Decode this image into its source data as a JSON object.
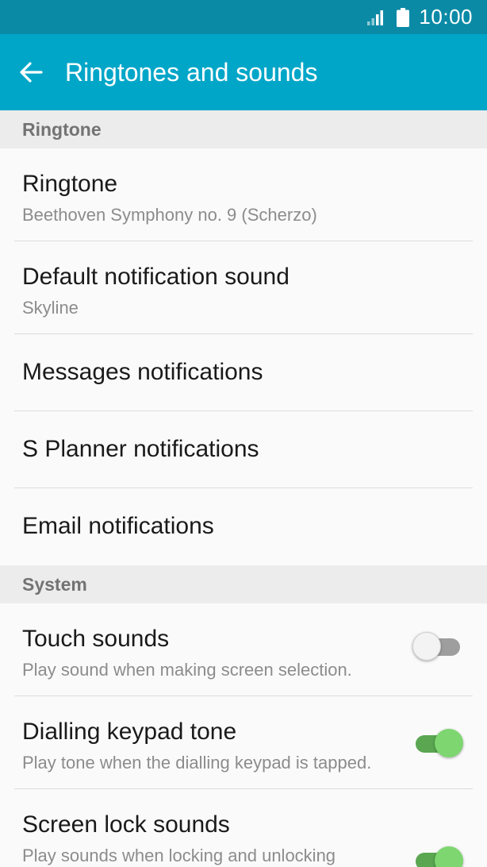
{
  "status_bar": {
    "time": "10:00",
    "icons": [
      "signal-icon",
      "battery-icon"
    ]
  },
  "app_bar": {
    "title": "Ringtones and sounds",
    "back_icon": "arrow-left-icon",
    "color": "#00a6c8"
  },
  "sections": {
    "ringtone": {
      "header": "Ringtone",
      "items": [
        {
          "title": "Ringtone",
          "subtitle": "Beethoven Symphony no. 9 (Scherzo)"
        },
        {
          "title": "Default notification sound",
          "subtitle": "Skyline"
        },
        {
          "title": "Messages notifications"
        },
        {
          "title": "S Planner notifications"
        },
        {
          "title": "Email notifications"
        }
      ]
    },
    "system": {
      "header": "System",
      "items": [
        {
          "title": "Touch sounds",
          "subtitle": "Play sound when making screen selection.",
          "toggle": false
        },
        {
          "title": "Dialling keypad tone",
          "subtitle": "Play tone when the dialling keypad is tapped.",
          "toggle": true
        },
        {
          "title": "Screen lock sounds",
          "subtitle": "Play sounds when locking and unlocking",
          "toggle": true
        }
      ]
    }
  },
  "colors": {
    "status_bar": "#0b8aa6",
    "toggle_on": "#7dd66f",
    "toggle_off": "#9e9e9e"
  }
}
